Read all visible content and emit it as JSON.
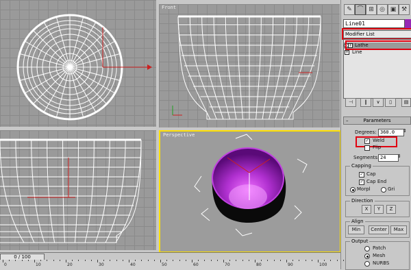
{
  "viewports": {
    "top": {
      "label": ""
    },
    "front": {
      "label": "Front"
    },
    "left": {
      "label": ""
    },
    "perspective": {
      "label": "Perspective"
    }
  },
  "command_panel": {
    "tab_icons": [
      "create-icon",
      "modify-icon",
      "hierarchy-icon",
      "motion-icon",
      "display-icon",
      "utilities-icon"
    ],
    "object_name": "Line01",
    "object_color": "#9628b4",
    "modifier_list_label": "Modifier List",
    "stack": [
      {
        "label": "Lathe",
        "selected": true
      },
      {
        "label": "Line",
        "selected": false
      }
    ],
    "parameters": {
      "rollout_title": "Parameters",
      "degrees_label": "Degrees:",
      "degrees_value": "360.0",
      "weld_label": "Weld",
      "weld_checked": true,
      "flip_label": "Flip",
      "flip_checked": false,
      "segments_label": "Segments:",
      "segments_value": "24",
      "capping": {
        "title": "Capping",
        "cap_start_label": "Cap",
        "cap_end_label": "Cap End",
        "morph_label": "Morpl",
        "grid_label": "Gri"
      },
      "direction": {
        "title": "Direction",
        "buttons": [
          "X",
          "Y",
          "Z"
        ]
      },
      "align": {
        "title": "Align",
        "buttons": [
          "Min",
          "Center",
          "Max"
        ]
      },
      "output": {
        "title": "Output",
        "options": [
          "Patch",
          "Mesh",
          "NURBS"
        ],
        "selected": "Mesh"
      }
    }
  },
  "timeline": {
    "frame_display": "0 / 100",
    "ticks": [
      "0",
      "10",
      "20",
      "30",
      "40",
      "50",
      "60",
      "70",
      "80",
      "90",
      "100"
    ]
  },
  "colors": {
    "highlight": "#e00010",
    "active_viewport_border": "#ffe000",
    "mesh_color": "#a020c0"
  }
}
